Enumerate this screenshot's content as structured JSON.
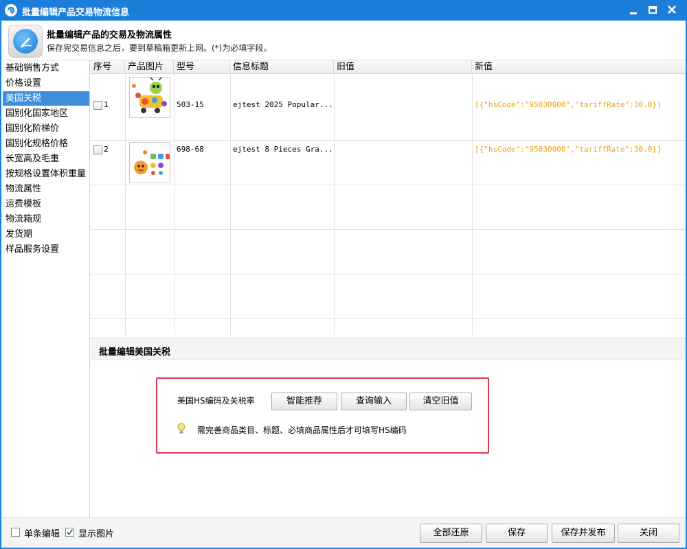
{
  "window": {
    "title": "批量编辑产品交易物流信息",
    "controls": {
      "minimize": "—",
      "maximize": "□",
      "close": "✕"
    }
  },
  "header": {
    "title": "批量编辑产品的交易及物流属性",
    "subtitle": "保存完交易信息之后，要到草稿箱更新上网。(*)为必填字段。"
  },
  "sidebar": {
    "items": [
      {
        "label": "基础销售方式",
        "active": false
      },
      {
        "label": "价格设置",
        "active": false
      },
      {
        "label": "美国关税",
        "active": true
      },
      {
        "label": "国别化国家地区",
        "active": false
      },
      {
        "label": "国别化阶梯价",
        "active": false
      },
      {
        "label": "国别化规格价格",
        "active": false
      },
      {
        "label": "长宽高及毛重",
        "active": false
      },
      {
        "label": "按规格设置体积重量",
        "active": false
      },
      {
        "label": "物流属性",
        "active": false
      },
      {
        "label": "运费模板",
        "active": false
      },
      {
        "label": "物流箱规",
        "active": false
      },
      {
        "label": "发货期",
        "active": false
      },
      {
        "label": "样品服务设置",
        "active": false
      }
    ]
  },
  "table": {
    "columns": [
      "序号",
      "产品图片",
      "型号",
      "信息标题",
      "旧值",
      "新值"
    ],
    "rows": [
      {
        "index": "1",
        "model": "503-15",
        "title": "ejtest 2025 Popular...",
        "old_value": "",
        "new_value": "[{\"hsCode\":\"95030000\",\"tariffRate\":30.0}]",
        "checked": false
      },
      {
        "index": "2",
        "model": "698-68",
        "title": "ejtest 8 Pieces Gra...",
        "old_value": "",
        "new_value": "[{\"hsCode\":\"95030000\",\"tariffRate\":30.0}]",
        "checked": false
      }
    ]
  },
  "section": {
    "title": "批量编辑美国关税"
  },
  "panel": {
    "label": "美国HS编码及关税率",
    "buttons": {
      "smart": "智能推荐",
      "query": "查询输入",
      "clear": "清空旧值"
    },
    "tip": "需完善商品类目、标题、必填商品属性后才可填写HS编码"
  },
  "footer": {
    "single_edit": {
      "label": "单条编辑",
      "checked": false
    },
    "show_images": {
      "label": "显示图片",
      "checked": true
    },
    "buttons": {
      "restore": "全部还原",
      "save": "保存",
      "save_publish": "保存并发布",
      "close": "关闭"
    }
  },
  "colors": {
    "titlebar": "#1b7fd9",
    "active_item": "#3d8fdc",
    "new_value": "#e8a21a",
    "panel_border": "#e0344f"
  }
}
